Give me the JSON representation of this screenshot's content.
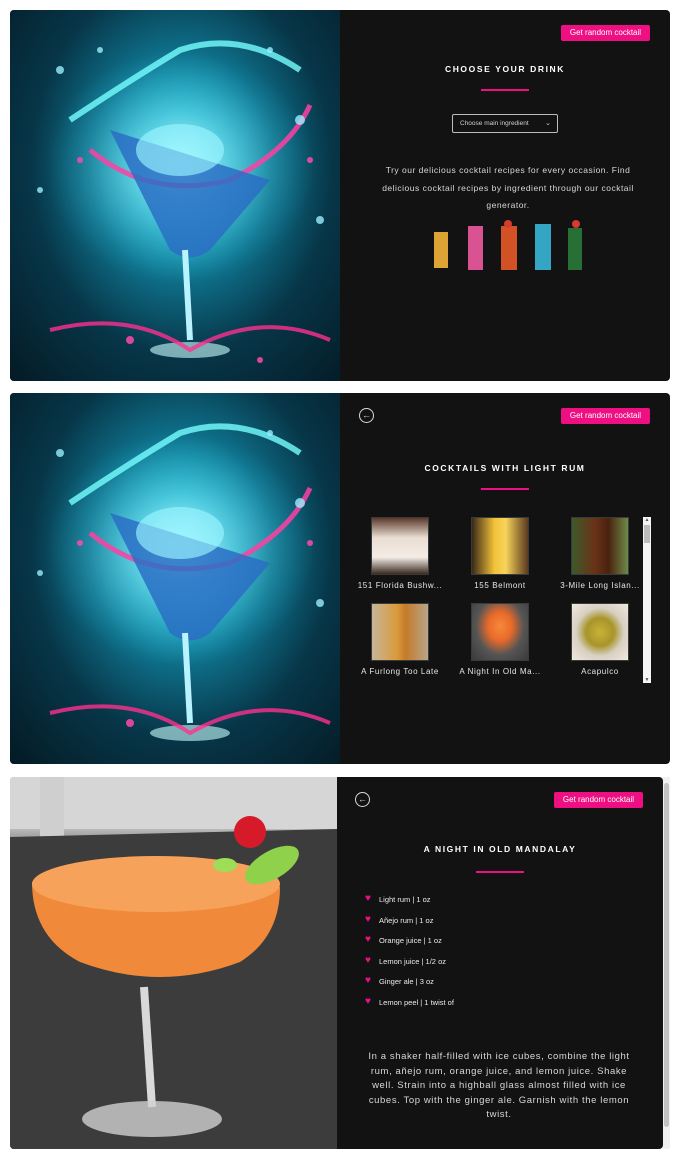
{
  "colors": {
    "accent": "#ee0f82",
    "panel_bg": "#121212"
  },
  "panel1": {
    "random_button": "Get random cocktail",
    "title": "CHOOSE YOUR DRINK",
    "select_value": "Choose main ingredient",
    "intro": "Try our delicious cocktail recipes for every occasion. Find delicious cocktail recipes by ingredient through our cocktail generator."
  },
  "panel2": {
    "back_icon": "arrow-left-circle",
    "random_button": "Get random cocktail",
    "title": "COCKTAILS WITH LIGHT RUM",
    "cocktails": [
      {
        "name": "151 Florida Bushw..."
      },
      {
        "name": "155 Belmont"
      },
      {
        "name": "3-Mile Long Islan..."
      },
      {
        "name": "A Furlong Too Late"
      },
      {
        "name": "A Night In Old Ma..."
      },
      {
        "name": "Acapulco"
      }
    ]
  },
  "panel3": {
    "back_icon": "arrow-left-circle",
    "random_button": "Get random cocktail",
    "title": "A NIGHT IN OLD MANDALAY",
    "ingredients": [
      "Light rum | 1 oz",
      "Añejo rum | 1 oz",
      "Orange juice | 1 oz",
      "Lemon juice | 1/2 oz",
      "Ginger ale | 3 oz",
      "Lemon peel | 1 twist of"
    ],
    "instructions": "In a shaker half-filled with ice cubes, combine the light rum, añejo rum, orange juice, and lemon juice. Shake well. Strain into a highball glass almost filled with ice cubes. Top with the ginger ale. Garnish with the lemon twist."
  }
}
